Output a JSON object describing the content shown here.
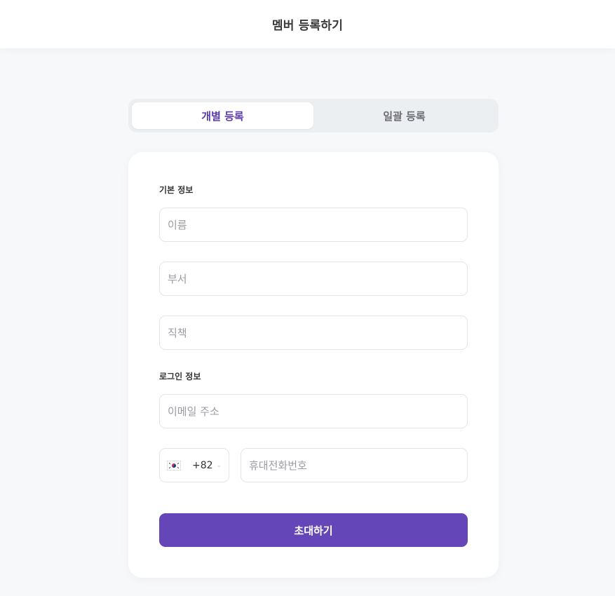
{
  "header": {
    "title": "멤버 등록하기"
  },
  "tabs": [
    {
      "label": "개별 등록",
      "active": true
    },
    {
      "label": "일괄 등록",
      "active": false
    }
  ],
  "form": {
    "basic_section_label": "기본 정보",
    "name_placeholder": "이름",
    "department_placeholder": "부서",
    "position_placeholder": "직책",
    "login_section_label": "로그인 정보",
    "email_placeholder": "이메일 주소",
    "country_flag": "south-korea-flag-icon",
    "country_code": "+82",
    "phone_placeholder": "휴대전화번호",
    "submit_label": "초대하기"
  },
  "colors": {
    "accent": "#6546b8",
    "active_tab_text": "#5b3cae",
    "background": "#f7f8fa"
  }
}
